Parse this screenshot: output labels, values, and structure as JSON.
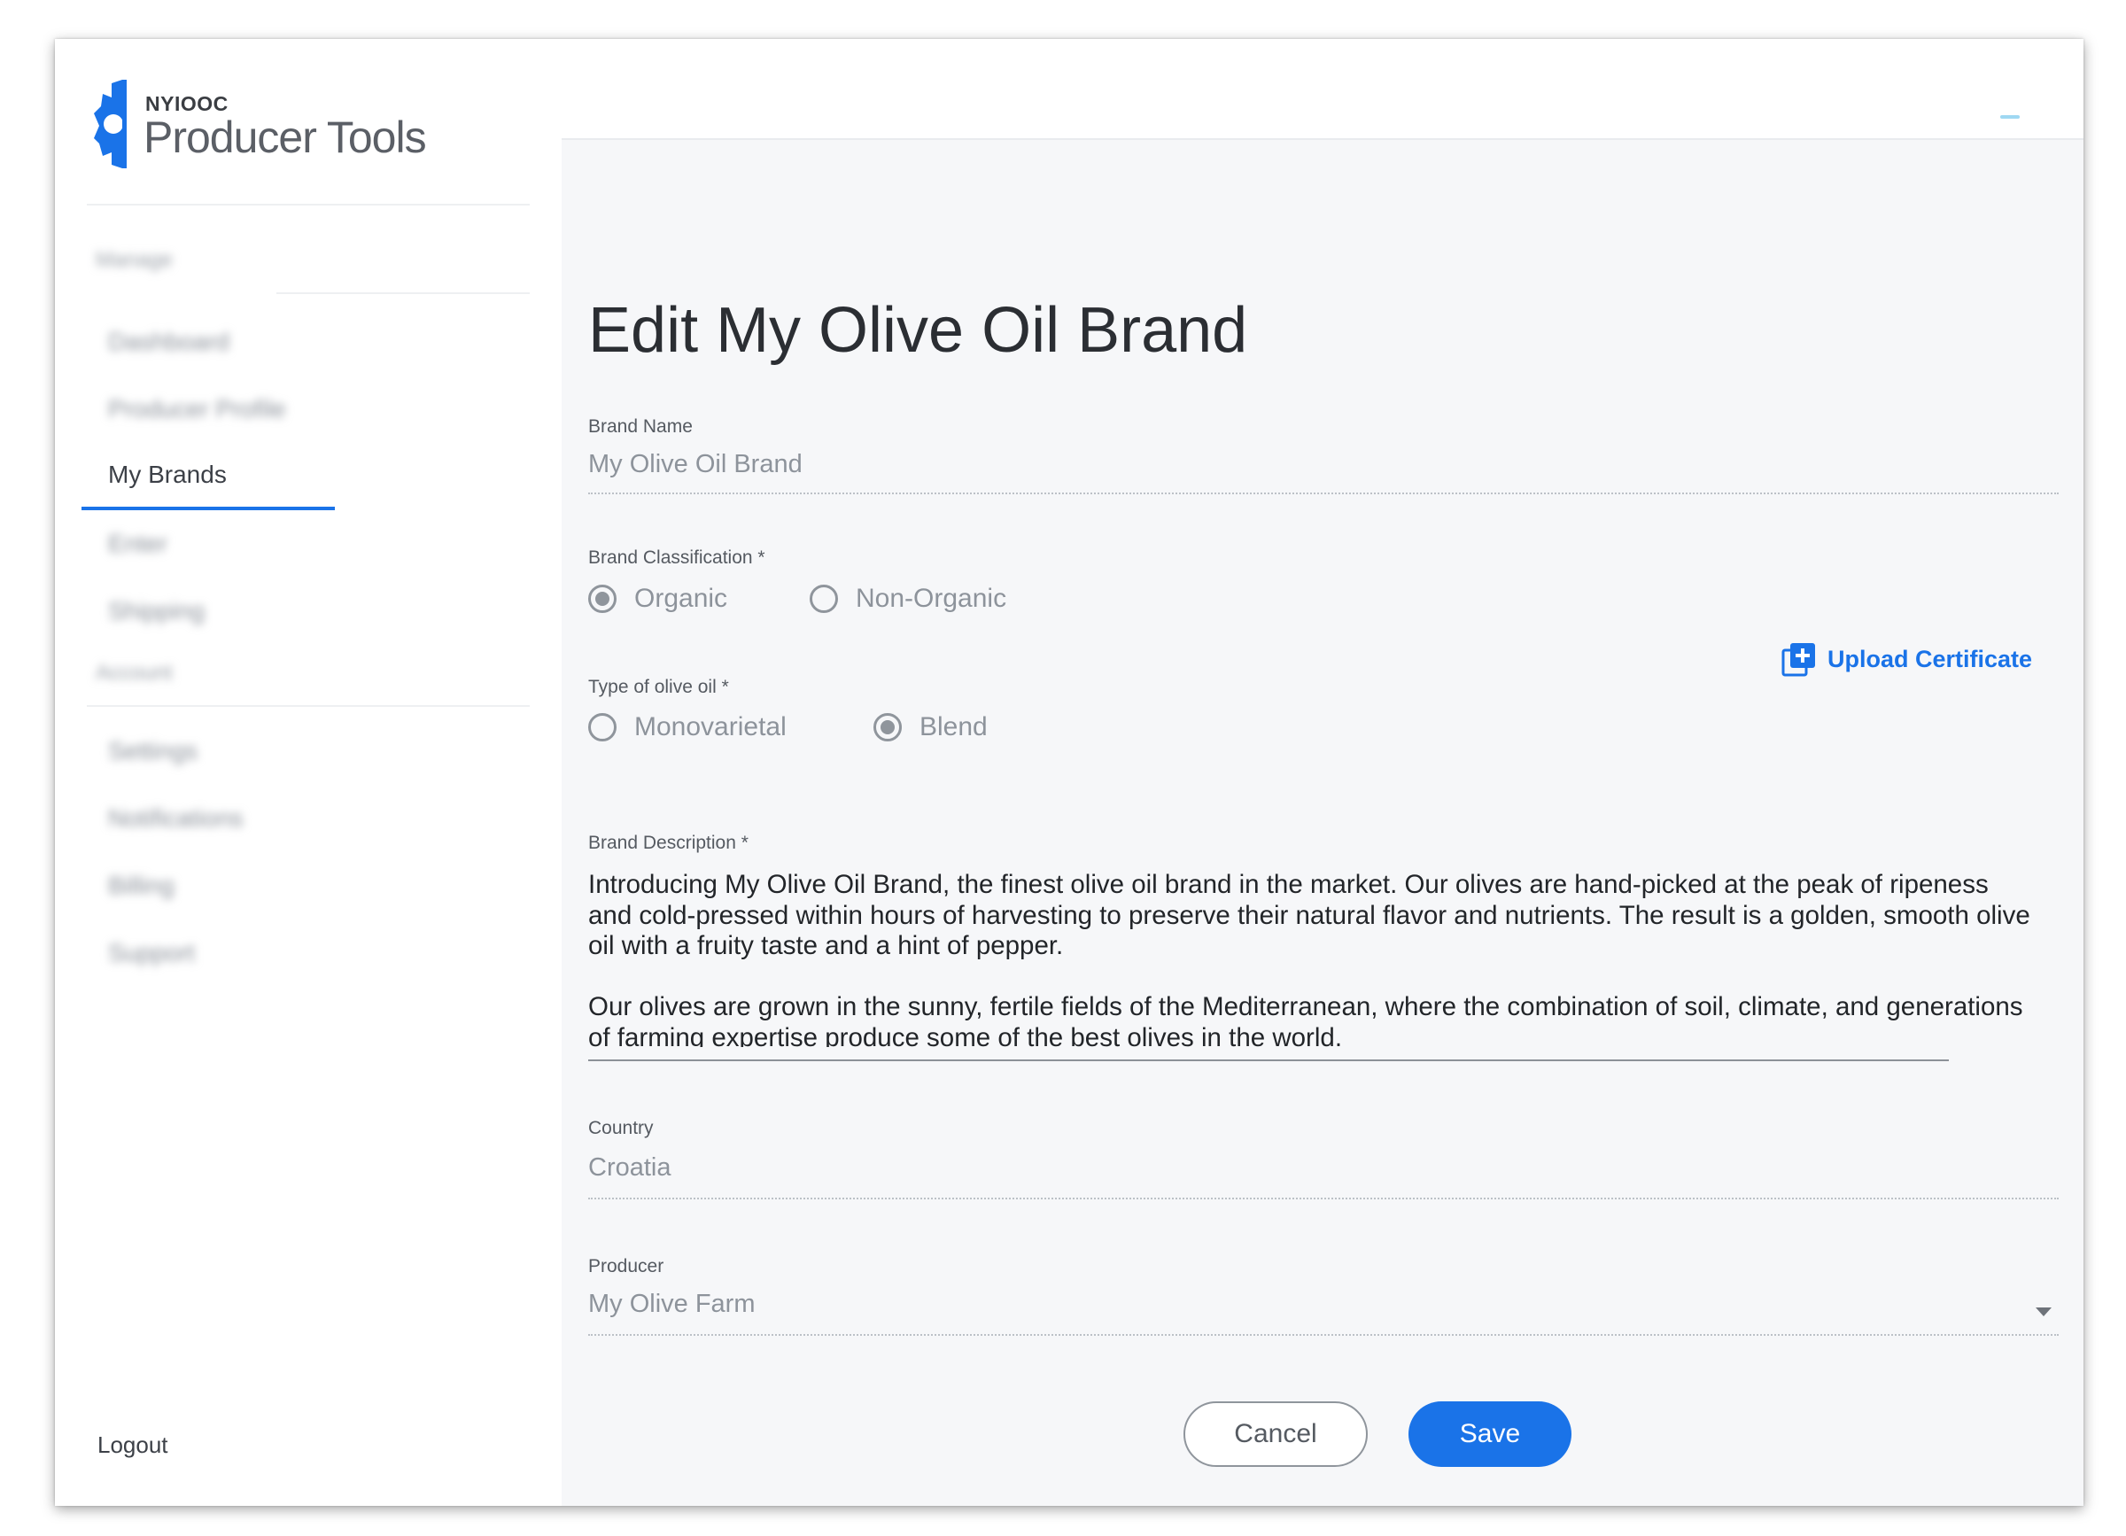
{
  "app": {
    "logo_small": "NYIOOC",
    "logo_big": "Producer Tools",
    "brand_color": "#1a73e8"
  },
  "sidebar": {
    "sections": [
      {
        "label": "Manage"
      },
      {
        "label": "Account"
      }
    ],
    "items": [
      {
        "label": "Dashboard"
      },
      {
        "label": "Producer Profile"
      },
      {
        "label": "My Brands",
        "active": true
      },
      {
        "label": "Enter"
      },
      {
        "label": "Shipping"
      },
      {
        "label": "Settings"
      },
      {
        "label": "Notifications"
      },
      {
        "label": "Billing"
      },
      {
        "label": "Support"
      }
    ],
    "logout_label": "Logout"
  },
  "form": {
    "title": "Edit My Olive Oil Brand",
    "brand_name": {
      "label": "Brand Name",
      "value": "My Olive Oil Brand"
    },
    "classification": {
      "label": "Brand Classification  *",
      "options": [
        "Organic",
        "Non-Organic"
      ],
      "selected": "Organic",
      "upload_label": "Upload Certificate",
      "upload_icon": "add-box-icon"
    },
    "oil_type": {
      "label": "Type of olive oil  *",
      "options": [
        "Monovarietal",
        "Blend"
      ],
      "selected": "Blend"
    },
    "description": {
      "label": "Brand Description *",
      "paragraph_1": "Introducing My Olive Oil Brand, the finest olive oil brand in the market. Our olives are hand-picked at the peak of ripeness and cold-pressed within hours of harvesting to preserve their natural flavor and nutrients. The result is a golden, smooth olive oil with a fruity taste and a hint of pepper.",
      "paragraph_2": "Our olives are grown in the sunny, fertile fields of the Mediterranean, where the combination of soil, climate, and generations of farming expertise produce some of the best olives in the world."
    },
    "country": {
      "label": "Country",
      "value": "Croatia"
    },
    "producer": {
      "label": "Producer",
      "value": "My Olive Farm",
      "icon": "caret-down-icon"
    },
    "cancel_label": "Cancel",
    "save_label": "Save"
  }
}
